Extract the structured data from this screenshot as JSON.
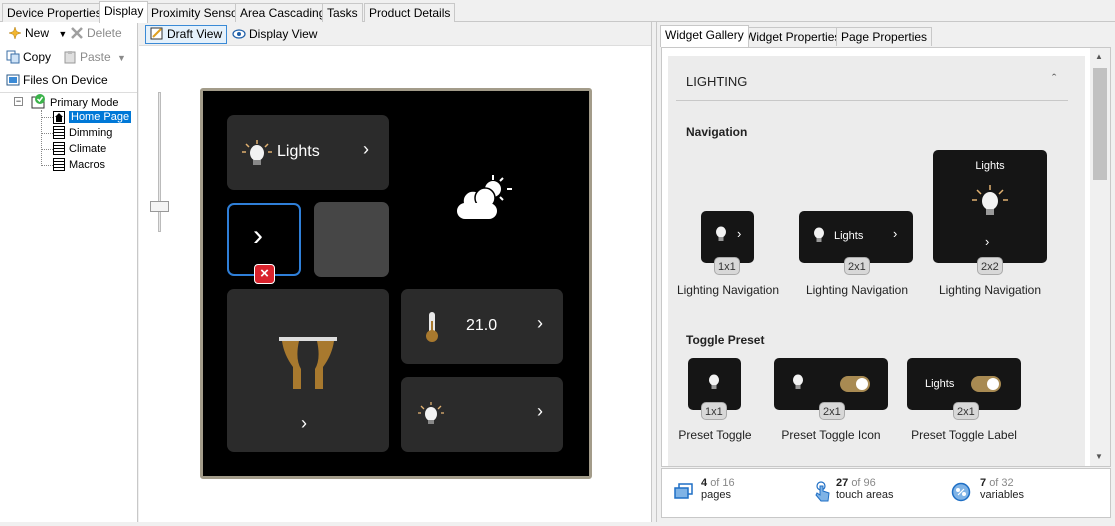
{
  "top_tabs": [
    "Device Properties",
    "Display",
    "Proximity Sensor",
    "Area Cascading",
    "Tasks",
    "Product Details"
  ],
  "toolbar": {
    "new_label": "New",
    "delete_label": "Delete",
    "copy_label": "Copy",
    "paste_label": "Paste",
    "files_label": "Files On Device"
  },
  "tree": {
    "root": "Primary Mode",
    "pages": [
      "Home Page",
      "Dimming",
      "Climate",
      "Macros"
    ]
  },
  "view": {
    "draft_label": "Draft View",
    "display_label": "Display View"
  },
  "device": {
    "lights_label": "Lights",
    "temperature": "21.0"
  },
  "right_tabs": [
    "Widget Gallery",
    "Widget Properties",
    "Page Properties"
  ],
  "gallery": {
    "section_title": "LIGHTING",
    "navigation_title": "Navigation",
    "nav_widgets": [
      {
        "size": "1x1",
        "label": "Lighting Navigation"
      },
      {
        "size": "2x1",
        "label": "Lighting Navigation",
        "text": "Lights"
      },
      {
        "size": "2x2",
        "label": "Lighting Navigation",
        "text": "Lights"
      }
    ],
    "toggle_title": "Toggle Preset",
    "toggle_widgets": [
      {
        "size": "1x1",
        "label": "Preset Toggle"
      },
      {
        "size": "2x1",
        "label": "Preset Toggle Icon"
      },
      {
        "size": "2x1",
        "label": "Preset Toggle Label",
        "text": "Lights"
      }
    ]
  },
  "stats": {
    "pages": {
      "count": "4",
      "total": "of 16",
      "label": "pages"
    },
    "touch": {
      "count": "27",
      "total": "of 96",
      "label": "touch areas"
    },
    "vars": {
      "count": "7",
      "total": "of 32",
      "label": "variables"
    }
  },
  "colors": {
    "accent": "#0078d7",
    "toggle": "#a88a52",
    "selected_tile_border": "#2f7fd8",
    "delete_badge": "#d9232d"
  }
}
